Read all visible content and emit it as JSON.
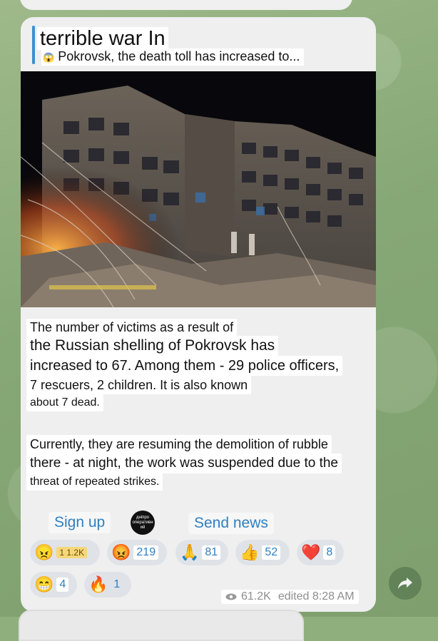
{
  "post": {
    "title": "terrible war In",
    "subtitle_emoji": "😱",
    "subtitle": "Pokrovsk, the death toll has increased to...",
    "paragraph1": [
      "The number of victims as a result of",
      "the Russian shelling of Pokrovsk has",
      "increased to 67. Among them - 29 police officers,",
      "7 rescuers, 2 children. It is also known",
      "about 7 dead."
    ],
    "paragraph2": [
      "Currently, they are resuming the demolition of rubble",
      "there - at night, the work was suspended due to the",
      "threat of repeated strikes."
    ]
  },
  "buttons": {
    "sign_up": "Sign up",
    "send_news": "Send news",
    "channel_logo_text": "дніпро оперативний"
  },
  "reactions": [
    {
      "emoji": "😠",
      "count": "1.2K",
      "badge": "1 1.2K"
    },
    {
      "emoji": "😡",
      "count": "219"
    },
    {
      "emoji": "🙏",
      "count": "81"
    },
    {
      "emoji": "👍",
      "count": "52"
    },
    {
      "emoji": "❤️",
      "count": "8"
    },
    {
      "emoji": "😁",
      "count": "4"
    },
    {
      "emoji": "🔥",
      "count": "1"
    }
  ],
  "meta": {
    "views": "61.2K",
    "status": "edited 8:28 AM"
  },
  "colors": {
    "accent": "#3d8fd1",
    "link": "#2f7fc0",
    "bubble": "#efefef"
  }
}
